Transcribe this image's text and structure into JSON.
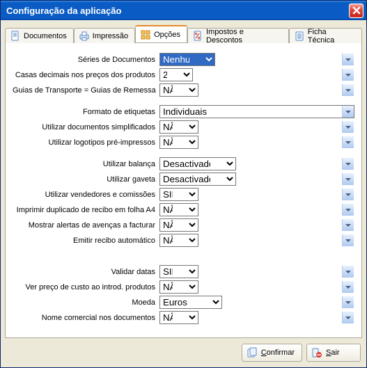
{
  "window": {
    "title": "Configuração da aplicação"
  },
  "tabs": {
    "documentos": "Documentos",
    "impressao": "Impressão",
    "opcoes": "Opções",
    "impostos": "Impostos e Descontos",
    "ficha": "Ficha Técnica"
  },
  "labels": {
    "series": "Séries de Documentos",
    "casas": "Casas decimais nos preços dos produtos",
    "guias": "Guias de Transporte = Guias de Remessa",
    "etiquetas": "Formato de etiquetas",
    "simplificados": "Utilizar documentos simplificados",
    "logotipos": "Utilizar logotipos pré-impressos",
    "balanca": "Utilizar balança",
    "gaveta": "Utilizar gaveta",
    "vendedores": "Utilizar vendedores e comissões",
    "duplicado": "Imprimir duplicado de recibo em folha A4",
    "alertas": "Mostrar alertas de avenças a facturar",
    "recibo": "Emitir recibo automático",
    "validar": "Validar datas",
    "precocusto": "Ver preço de custo ao introd. produtos",
    "moeda": "Moeda",
    "comercial": "Nome comercial nos documentos"
  },
  "values": {
    "series": "Nenhuma",
    "casas": "2",
    "guias": "NÃO",
    "etiquetas": "Individuais",
    "simplificados": "NÃO",
    "logotipos": "NÃO",
    "balanca": "Desactivado",
    "gaveta": "Desactivado",
    "vendedores": "SIM",
    "duplicado": "NÃO",
    "alertas": "NÃO",
    "recibo": "NÃO",
    "validar": "SIM",
    "precocusto": "NÃO",
    "moeda": "Euros",
    "comercial": "NÃO"
  },
  "buttons": {
    "confirmar": "Confirmar",
    "sair": "Sair"
  }
}
